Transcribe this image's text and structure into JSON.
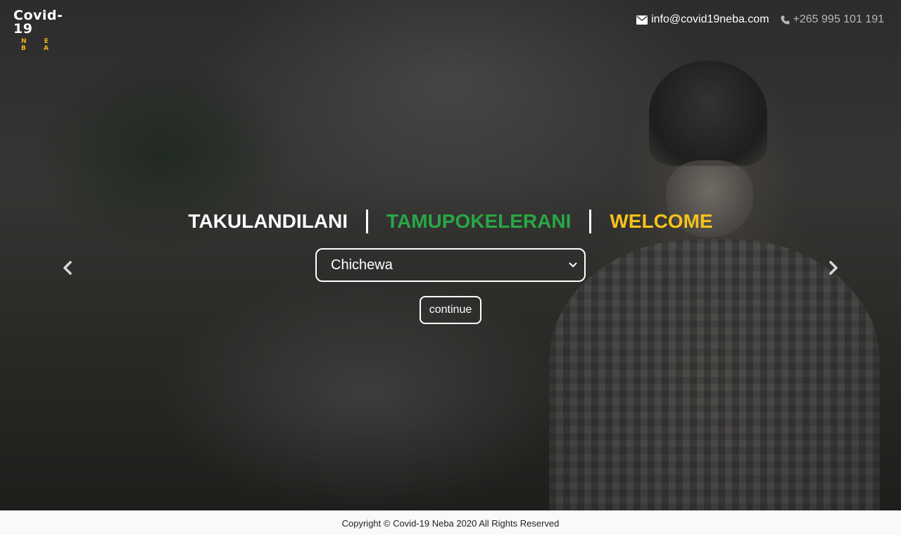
{
  "brand": {
    "name": "Covid-19",
    "tagline": "N E B A"
  },
  "contact": {
    "email_icon": "envelope-icon",
    "email": "info@covid19neba.com",
    "phone_icon": "phone-icon",
    "phone": "+265 995 101 191"
  },
  "carousel": {
    "prev_icon": "chevron-left-icon",
    "next_icon": "chevron-right-icon",
    "prev_label": "Previous",
    "next_label": "Next"
  },
  "welcome": {
    "words": [
      {
        "text": "TAKULANDILANI",
        "color": "#ffffff"
      },
      {
        "text": "TAMUPOKELERANI",
        "color": "#28a745"
      },
      {
        "text": "WELCOME",
        "color": "#f5c21b"
      }
    ]
  },
  "language_select": {
    "selected": "Chichewa"
  },
  "continue_button": {
    "label": "continue"
  },
  "footer": {
    "copyright": "Copyright © Covid-19 Neba 2020 All Rights Reserved"
  }
}
